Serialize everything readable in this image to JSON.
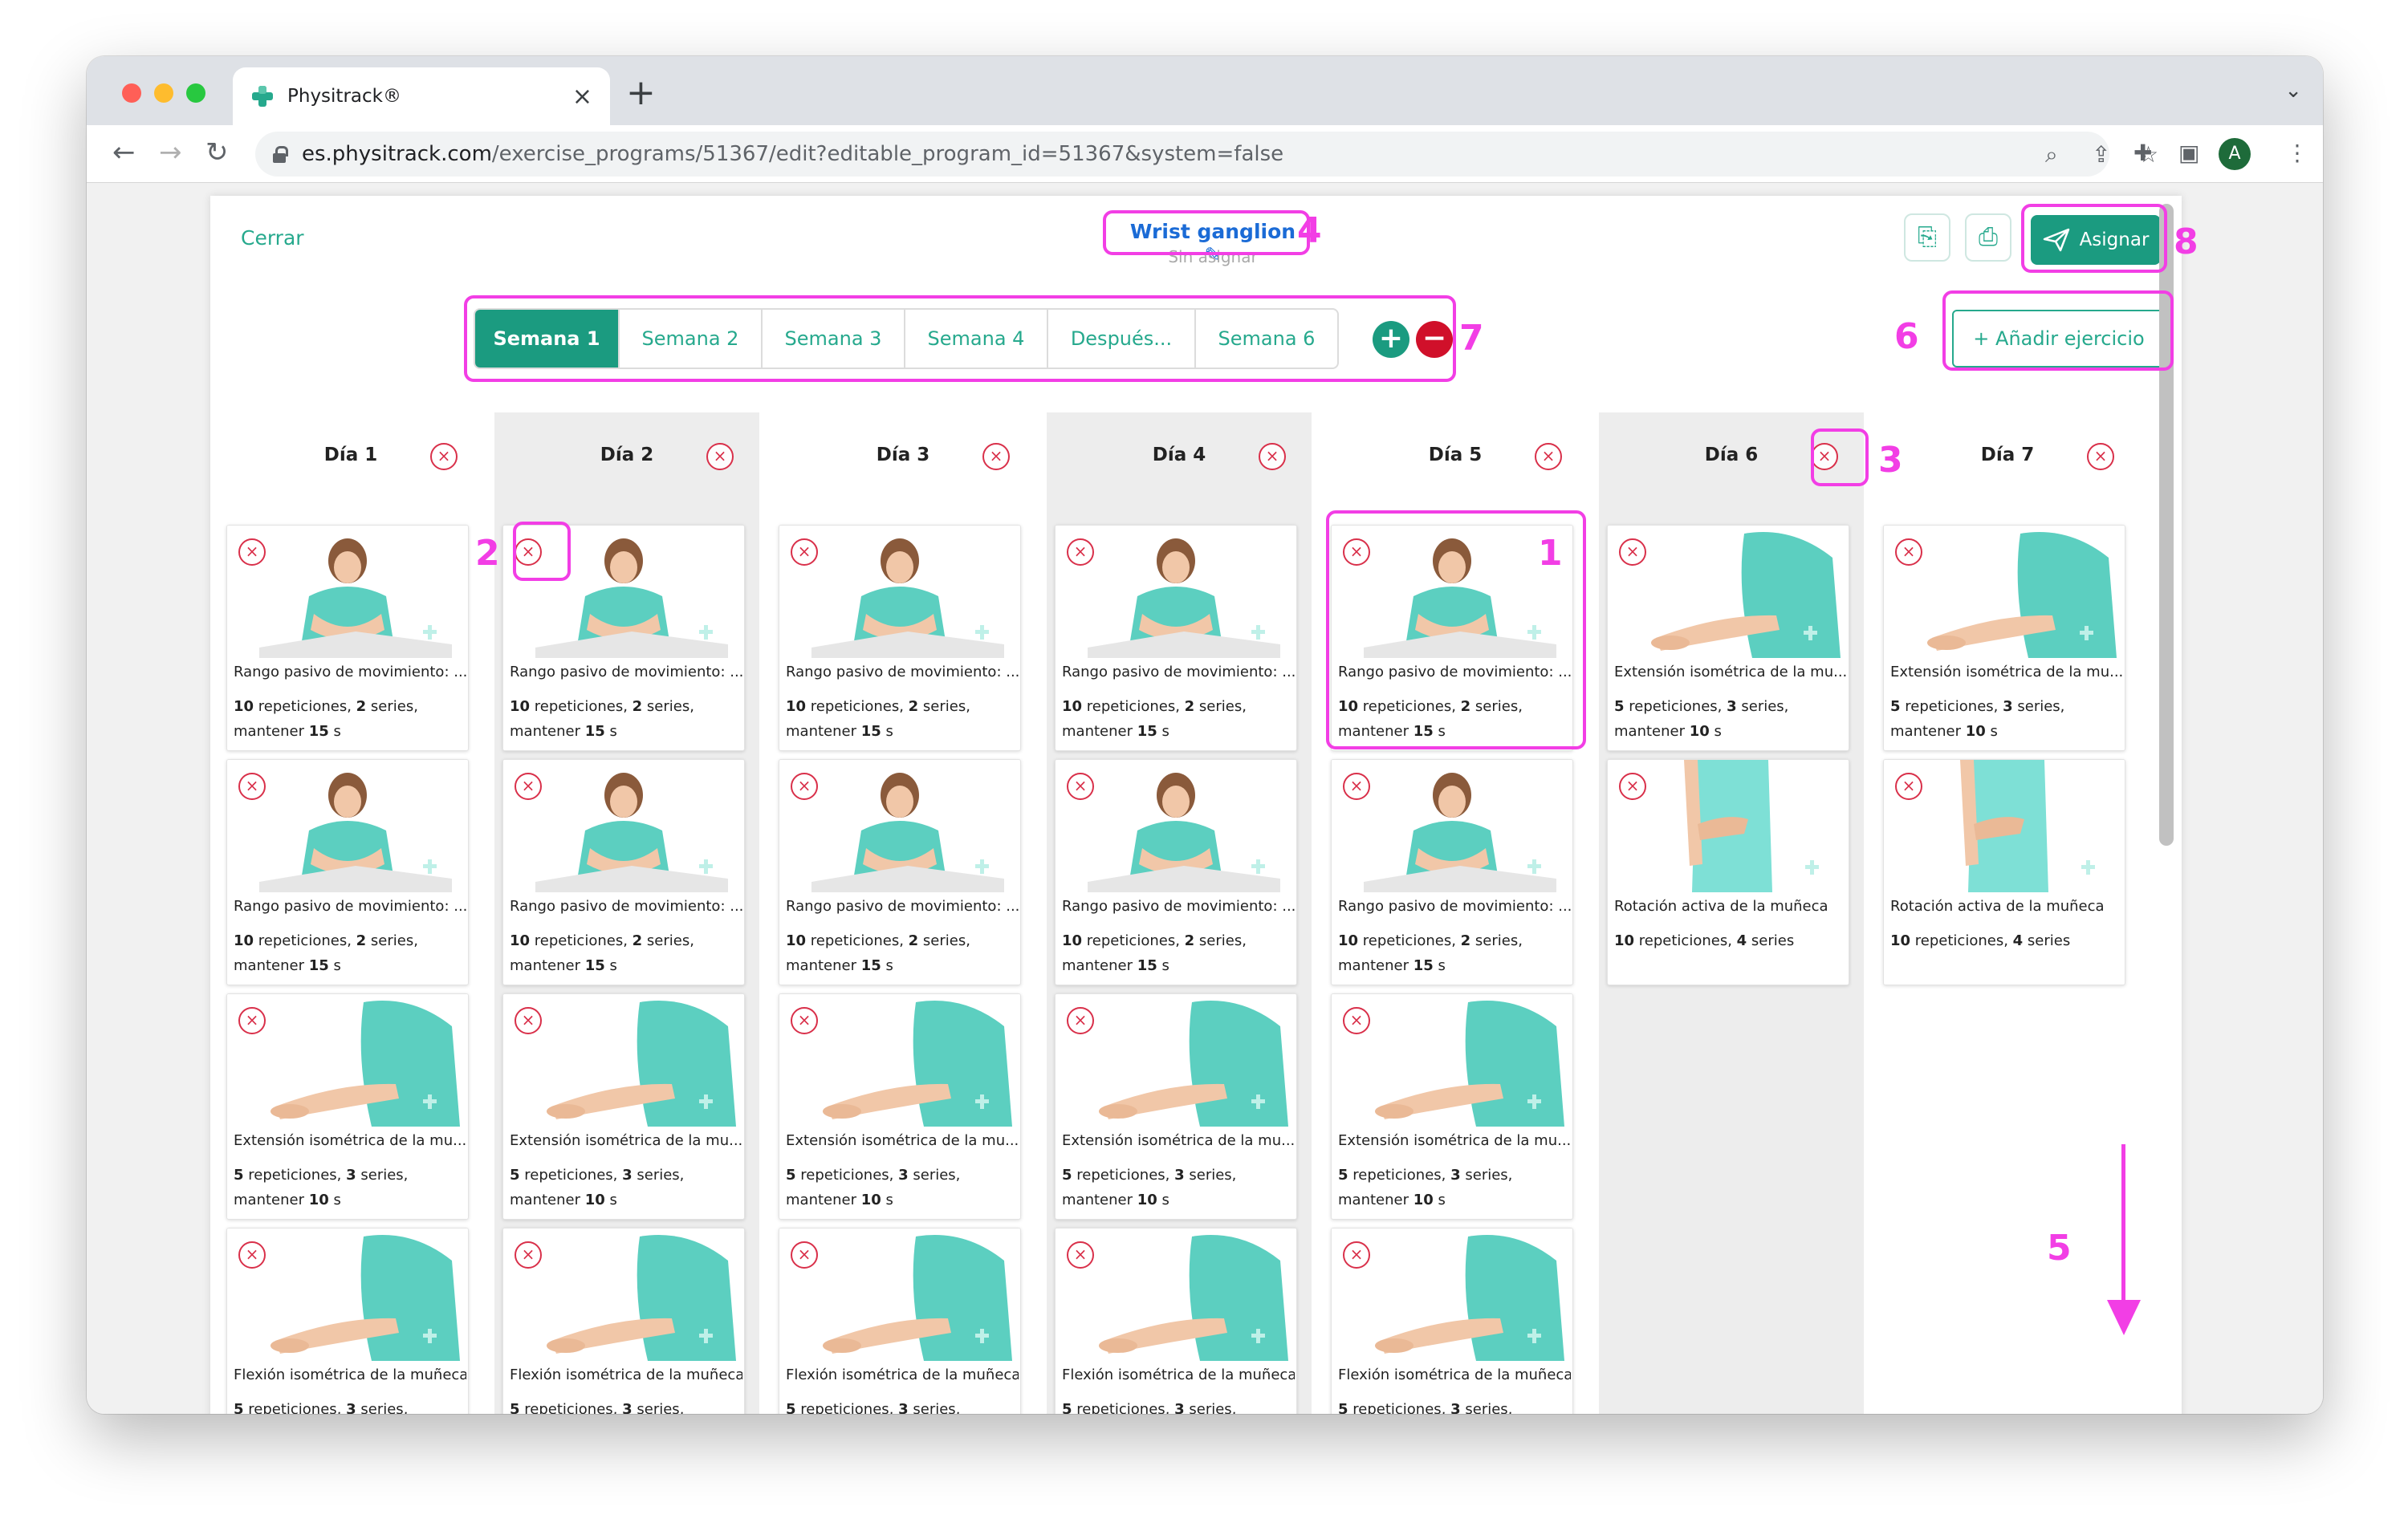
{
  "browser": {
    "tab_title": "Physitrack®",
    "url_domain": "es.physitrack.com",
    "url_path": "/exercise_programs/51367/edit?editable_program_id=51367&system=false",
    "avatar_letter": "A"
  },
  "header": {
    "close_label": "Cerrar",
    "program_title": "Wrist ganglion",
    "program_status": "Sin asignar",
    "assign_label": "Asignar",
    "add_exercise_label": "+ Añadir ejercicio"
  },
  "weeks": [
    "Semana 1",
    "Semana 2",
    "Semana 3",
    "Semana 4",
    "Después...",
    "Semana 6"
  ],
  "days": [
    {
      "label": "Día 1",
      "exercises": [
        0,
        0,
        1,
        2
      ]
    },
    {
      "label": "Día 2",
      "exercises": [
        0,
        0,
        1,
        2
      ]
    },
    {
      "label": "Día 3",
      "exercises": [
        0,
        0,
        1,
        2
      ]
    },
    {
      "label": "Día 4",
      "exercises": [
        0,
        0,
        1,
        2
      ]
    },
    {
      "label": "Día 5",
      "exercises": [
        0,
        0,
        1,
        2
      ]
    },
    {
      "label": "Día 6",
      "exercises": [
        1,
        3
      ]
    },
    {
      "label": "Día 7",
      "exercises": [
        1,
        3
      ]
    }
  ],
  "exercise_types": [
    {
      "title": "Rango pasivo de movimiento: ...",
      "reps": "10",
      "reps_label": " repeticiones, ",
      "sets": "2",
      "sets_label": " series,",
      "hold_label": "mantener ",
      "hold": "15",
      "hold_unit": " s",
      "image": "passive"
    },
    {
      "title": "Extensión isométrica de la mu...",
      "reps": "5",
      "reps_label": " repeticiones, ",
      "sets": "3",
      "sets_label": " series,",
      "hold_label": "mantener ",
      "hold": "10",
      "hold_unit": " s",
      "image": "iso"
    },
    {
      "title": "Flexión isométrica de la muñeca",
      "reps": "5",
      "reps_label": " repeticiones, ",
      "sets": "3",
      "sets_label": " series,",
      "hold_label": "",
      "hold": "",
      "hold_unit": "",
      "image": "iso"
    },
    {
      "title": "Rotación activa de la muñeca",
      "reps": "10",
      "reps_label": " repeticiones, ",
      "sets": "4",
      "sets_label": " series",
      "hold_label": "",
      "hold": "",
      "hold_unit": "",
      "image": "rotation"
    }
  ],
  "annotations": [
    "1",
    "2",
    "3",
    "4",
    "5",
    "6",
    "7",
    "8"
  ],
  "help_label": "?",
  "colors": {
    "brand": "#1b9b80",
    "brand_text": "#26a98d",
    "delete": "#d9304a",
    "highlight": "#f23ee5",
    "title_link": "#1b6bd6"
  },
  "icons": [
    "lock-icon",
    "zoom-icon",
    "share-icon",
    "star-icon",
    "extension-icon",
    "sidepanel-icon",
    "menu-icon",
    "copy-icon",
    "print-icon",
    "send-icon",
    "plus-icon",
    "minus-icon",
    "close-icon",
    "help-icon"
  ]
}
